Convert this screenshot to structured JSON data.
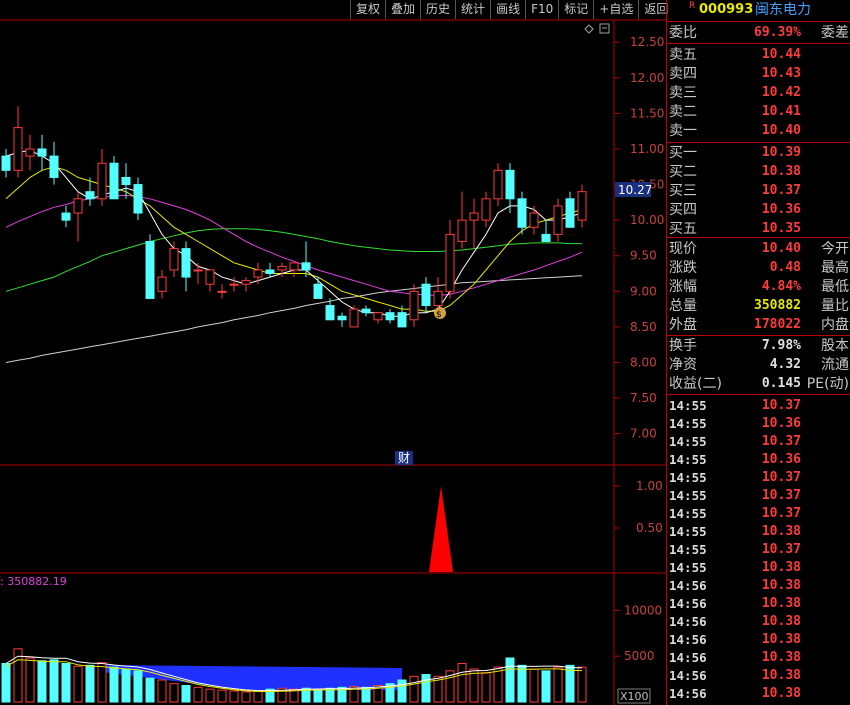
{
  "toolbar": [
    "复权",
    "叠加",
    "历史",
    "统计",
    "画线",
    "F10",
    "标记",
    "+自选",
    "返回"
  ],
  "stock": {
    "badge": "R",
    "code": "000993",
    "name": "闽东电力"
  },
  "price_axis": {
    "ticks": [
      "12.50",
      "12.00",
      "11.50",
      "11.00",
      "10.50",
      "10.00",
      "9.50",
      "9.00",
      "8.50",
      "8.00",
      "7.50",
      "7.00"
    ],
    "current": "10.27"
  },
  "marker_label": "财",
  "event_axis": {
    "ticks": [
      "1.00",
      "0.50"
    ]
  },
  "volume_axis": {
    "ticks": [
      "10000",
      "5000"
    ],
    "unit": "X100"
  },
  "volume_readout": ": 350882.19",
  "quote": {
    "webi": {
      "label": "委比",
      "value": "69.39%",
      "label2": "委差"
    },
    "asks": [
      {
        "label": "卖五",
        "price": "10.44"
      },
      {
        "label": "卖四",
        "price": "10.43"
      },
      {
        "label": "卖三",
        "price": "10.42"
      },
      {
        "label": "卖二",
        "price": "10.41"
      },
      {
        "label": "卖一",
        "price": "10.40"
      }
    ],
    "bids": [
      {
        "label": "买一",
        "price": "10.39"
      },
      {
        "label": "买二",
        "price": "10.38"
      },
      {
        "label": "买三",
        "price": "10.37"
      },
      {
        "label": "买四",
        "price": "10.36"
      },
      {
        "label": "买五",
        "price": "10.35"
      }
    ],
    "stats": [
      {
        "label": "现价",
        "value": "10.40",
        "label2": "今开",
        "color": "red"
      },
      {
        "label": "涨跌",
        "value": "0.48",
        "label2": "最高",
        "color": "red"
      },
      {
        "label": "涨幅",
        "value": "4.84%",
        "label2": "最低",
        "color": "red"
      },
      {
        "label": "总量",
        "value": "350882",
        "label2": "量比",
        "color": "yellow"
      },
      {
        "label": "外盘",
        "value": "178022",
        "label2": "内盘",
        "color": "red"
      }
    ],
    "extra": [
      {
        "label": "换手",
        "value": "7.98%",
        "label2": "股本"
      },
      {
        "label": "净资",
        "value": "4.32",
        "label2": "流通"
      },
      {
        "label": "收益(二)",
        "value": "0.145",
        "label2": "PE(动)"
      }
    ],
    "ticks": [
      {
        "time": "14:55",
        "price": "10.37"
      },
      {
        "time": "14:55",
        "price": "10.36"
      },
      {
        "time": "14:55",
        "price": "10.37"
      },
      {
        "time": "14:55",
        "price": "10.36"
      },
      {
        "time": "14:55",
        "price": "10.37"
      },
      {
        "time": "14:55",
        "price": "10.37"
      },
      {
        "time": "14:55",
        "price": "10.37"
      },
      {
        "time": "14:55",
        "price": "10.38"
      },
      {
        "time": "14:55",
        "price": "10.37"
      },
      {
        "time": "14:55",
        "price": "10.38"
      },
      {
        "time": "14:56",
        "price": "10.38"
      },
      {
        "time": "14:56",
        "price": "10.38"
      },
      {
        "time": "14:56",
        "price": "10.38"
      },
      {
        "time": "14:56",
        "price": "10.38"
      },
      {
        "time": "14:56",
        "price": "10.38"
      },
      {
        "time": "14:56",
        "price": "10.38"
      },
      {
        "time": "14:56",
        "price": "10.38"
      }
    ]
  },
  "colors": {
    "up": "#ff3b3b",
    "down": "#54ffff",
    "grid": "#b00000",
    "ma5": "#ffffff",
    "ma10": "#e8e800",
    "ma20": "#e040e0",
    "ma30": "#30e030",
    "ma60": "#d0d0d0"
  },
  "chart_data": {
    "type": "candlestick",
    "ylim": [
      6.7,
      12.7
    ],
    "candles": [
      {
        "o": 10.9,
        "h": 11.0,
        "l": 10.6,
        "c": 10.7
      },
      {
        "o": 10.7,
        "h": 11.6,
        "l": 10.6,
        "c": 11.3
      },
      {
        "o": 10.9,
        "h": 11.2,
        "l": 10.7,
        "c": 11.0
      },
      {
        "o": 11.0,
        "h": 11.2,
        "l": 10.7,
        "c": 10.9
      },
      {
        "o": 10.9,
        "h": 11.1,
        "l": 10.5,
        "c": 10.6
      },
      {
        "o": 10.1,
        "h": 10.2,
        "l": 9.9,
        "c": 10.0
      },
      {
        "o": 10.1,
        "h": 10.4,
        "l": 9.7,
        "c": 10.3
      },
      {
        "o": 10.4,
        "h": 10.6,
        "l": 10.2,
        "c": 10.3
      },
      {
        "o": 10.3,
        "h": 11.0,
        "l": 10.2,
        "c": 10.8
      },
      {
        "o": 10.8,
        "h": 10.9,
        "l": 10.3,
        "c": 10.3
      },
      {
        "o": 10.6,
        "h": 10.8,
        "l": 10.3,
        "c": 10.5
      },
      {
        "o": 10.5,
        "h": 10.6,
        "l": 10.0,
        "c": 10.1
      },
      {
        "o": 9.7,
        "h": 9.8,
        "l": 8.9,
        "c": 8.9
      },
      {
        "o": 9.0,
        "h": 9.3,
        "l": 8.9,
        "c": 9.2
      },
      {
        "o": 9.3,
        "h": 9.7,
        "l": 9.2,
        "c": 9.6
      },
      {
        "o": 9.6,
        "h": 9.7,
        "l": 9.0,
        "c": 9.2
      },
      {
        "o": 9.3,
        "h": 9.4,
        "l": 9.1,
        "c": 9.3
      },
      {
        "o": 9.1,
        "h": 9.3,
        "l": 9.0,
        "c": 9.3
      },
      {
        "o": 9.0,
        "h": 9.1,
        "l": 8.9,
        "c": 9.0
      },
      {
        "o": 9.1,
        "h": 9.2,
        "l": 9.0,
        "c": 9.1
      },
      {
        "o": 9.1,
        "h": 9.2,
        "l": 9.0,
        "c": 9.15
      },
      {
        "o": 9.2,
        "h": 9.4,
        "l": 9.1,
        "c": 9.3
      },
      {
        "o": 9.3,
        "h": 9.4,
        "l": 9.2,
        "c": 9.25
      },
      {
        "o": 9.3,
        "h": 9.4,
        "l": 9.2,
        "c": 9.35
      },
      {
        "o": 9.3,
        "h": 9.4,
        "l": 9.2,
        "c": 9.4
      },
      {
        "o": 9.4,
        "h": 9.7,
        "l": 9.2,
        "c": 9.3
      },
      {
        "o": 9.1,
        "h": 9.2,
        "l": 8.9,
        "c": 8.9
      },
      {
        "o": 8.8,
        "h": 8.9,
        "l": 8.6,
        "c": 8.6
      },
      {
        "o": 8.65,
        "h": 8.7,
        "l": 8.5,
        "c": 8.6
      },
      {
        "o": 8.5,
        "h": 8.8,
        "l": 8.5,
        "c": 8.75
      },
      {
        "o": 8.75,
        "h": 8.8,
        "l": 8.65,
        "c": 8.7
      },
      {
        "o": 8.6,
        "h": 8.7,
        "l": 8.55,
        "c": 8.7
      },
      {
        "o": 8.7,
        "h": 8.75,
        "l": 8.55,
        "c": 8.6
      },
      {
        "o": 8.7,
        "h": 8.8,
        "l": 8.5,
        "c": 8.5
      },
      {
        "o": 8.6,
        "h": 9.1,
        "l": 8.5,
        "c": 9.0
      },
      {
        "o": 9.1,
        "h": 9.2,
        "l": 8.7,
        "c": 8.8
      },
      {
        "o": 8.8,
        "h": 9.2,
        "l": 8.7,
        "c": 9.0
      },
      {
        "o": 9.0,
        "h": 10.0,
        "l": 8.9,
        "c": 9.8
      },
      {
        "o": 9.7,
        "h": 10.4,
        "l": 9.6,
        "c": 10.0
      },
      {
        "o": 10.0,
        "h": 10.3,
        "l": 9.6,
        "c": 10.1
      },
      {
        "o": 10.0,
        "h": 10.4,
        "l": 9.9,
        "c": 10.3
      },
      {
        "o": 10.3,
        "h": 10.8,
        "l": 10.2,
        "c": 10.7
      },
      {
        "o": 10.7,
        "h": 10.8,
        "l": 10.1,
        "c": 10.3
      },
      {
        "o": 10.3,
        "h": 10.4,
        "l": 9.8,
        "c": 9.9
      },
      {
        "o": 9.9,
        "h": 10.2,
        "l": 9.8,
        "c": 10.1
      },
      {
        "o": 9.8,
        "h": 10.0,
        "l": 9.7,
        "c": 9.7
      },
      {
        "o": 9.8,
        "h": 10.3,
        "l": 9.7,
        "c": 10.2
      },
      {
        "o": 10.3,
        "h": 10.4,
        "l": 9.9,
        "c": 9.9
      },
      {
        "o": 10.0,
        "h": 10.5,
        "l": 9.9,
        "c": 10.4
      }
    ],
    "ma5": [
      10.9,
      10.95,
      10.98,
      10.9,
      10.8,
      10.6,
      10.4,
      10.3,
      10.35,
      10.4,
      10.45,
      10.4,
      10.1,
      9.8,
      9.6,
      9.5,
      9.35,
      9.3,
      9.2,
      9.15,
      9.1,
      9.15,
      9.2,
      9.25,
      9.3,
      9.3,
      9.15,
      9.0,
      8.85,
      8.75,
      8.7,
      8.7,
      8.65,
      8.65,
      8.7,
      8.7,
      8.75,
      9.0,
      9.3,
      9.55,
      9.8,
      10.1,
      10.2,
      10.2,
      10.15,
      10.0,
      10.0,
      10.05,
      10.1
    ],
    "ma10": [
      10.3,
      10.45,
      10.6,
      10.7,
      10.75,
      10.7,
      10.6,
      10.55,
      10.5,
      10.45,
      10.4,
      10.3,
      10.2,
      10.05,
      9.9,
      9.8,
      9.7,
      9.6,
      9.5,
      9.4,
      9.35,
      9.3,
      9.25,
      9.25,
      9.25,
      9.25,
      9.2,
      9.1,
      9.0,
      8.95,
      8.9,
      8.85,
      8.8,
      8.75,
      8.75,
      8.72,
      8.72,
      8.8,
      8.95,
      9.1,
      9.3,
      9.5,
      9.7,
      9.85,
      9.95,
      10.0,
      10.05,
      10.1,
      10.15
    ],
    "ma20": [
      9.9,
      9.98,
      10.05,
      10.12,
      10.18,
      10.22,
      10.27,
      10.3,
      10.32,
      10.34,
      10.35,
      10.33,
      10.3,
      10.25,
      10.2,
      10.15,
      10.08,
      10.0,
      9.9,
      9.8,
      9.7,
      9.62,
      9.55,
      9.48,
      9.42,
      9.36,
      9.3,
      9.25,
      9.2,
      9.15,
      9.1,
      9.05,
      9.0,
      8.98,
      8.96,
      8.95,
      8.94,
      8.96,
      9.0,
      9.05,
      9.1,
      9.15,
      9.2,
      9.25,
      9.3,
      9.36,
      9.42,
      9.48,
      9.55
    ],
    "ma30": [
      9.0,
      9.05,
      9.1,
      9.15,
      9.2,
      9.28,
      9.35,
      9.42,
      9.5,
      9.55,
      9.6,
      9.65,
      9.7,
      9.74,
      9.78,
      9.82,
      9.85,
      9.87,
      9.88,
      9.88,
      9.88,
      9.87,
      9.85,
      9.83,
      9.8,
      9.77,
      9.74,
      9.7,
      9.67,
      9.64,
      9.62,
      9.6,
      9.58,
      9.57,
      9.56,
      9.56,
      9.56,
      9.57,
      9.58,
      9.6,
      9.62,
      9.64,
      9.66,
      9.67,
      9.68,
      9.68,
      9.68,
      9.67,
      9.67
    ],
    "ma60": [
      8.0,
      8.03,
      8.06,
      8.1,
      8.13,
      8.16,
      8.19,
      8.22,
      8.25,
      8.28,
      8.31,
      8.34,
      8.37,
      8.4,
      8.43,
      8.46,
      8.5,
      8.53,
      8.56,
      8.6,
      8.63,
      8.66,
      8.7,
      8.73,
      8.76,
      8.8,
      8.83,
      8.86,
      8.9,
      8.92,
      8.95,
      8.98,
      9.0,
      9.02,
      9.04,
      9.06,
      9.08,
      9.1,
      9.12,
      9.13,
      9.14,
      9.15,
      9.16,
      9.17,
      9.18,
      9.19,
      9.2,
      9.21,
      9.22
    ],
    "event_signal": {
      "index": 36,
      "value": 1.0
    },
    "volumes": [
      4200,
      5800,
      4800,
      4500,
      4600,
      4200,
      3900,
      4000,
      4300,
      3800,
      3600,
      3400,
      2600,
      2400,
      2000,
      1800,
      1600,
      1400,
      1300,
      1200,
      1100,
      1200,
      1400,
      1500,
      1400,
      1500,
      1300,
      1500,
      1600,
      1700,
      1600,
      1800,
      2000,
      2400,
      2800,
      3000,
      2800,
      3400,
      4200,
      3600,
      3200,
      3800,
      4800,
      4000,
      3600,
      3400,
      3800,
      4000,
      3800
    ],
    "vol_ylim": [
      0,
      12000
    ]
  }
}
